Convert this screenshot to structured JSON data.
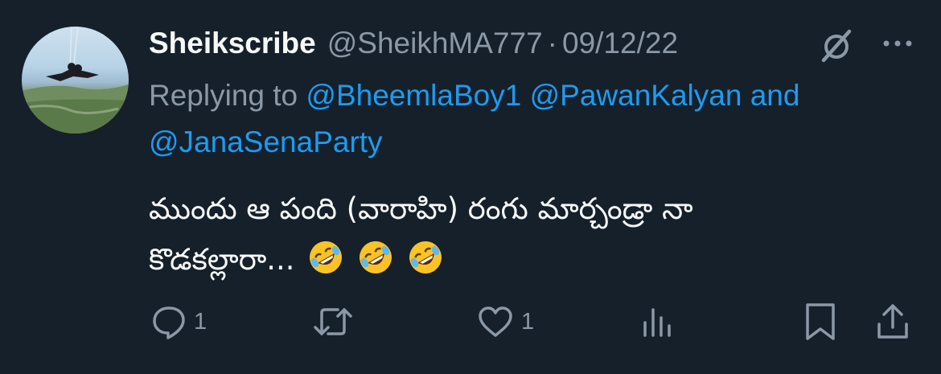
{
  "tweet": {
    "display_name": "Sheikscribe",
    "handle": "@SheikhMA777",
    "separator": "·",
    "date": "09/12/22",
    "replying_to_prefix": "Replying to",
    "mentions": [
      "@BheemlaBoy1",
      "@PawanKalyan",
      "@JanaSenaParty"
    ],
    "mention_conjunction": "and",
    "text_line1": "ముందు ఆ పంది (వారాహి) రంగు మార్చండ్రా నా",
    "text_line2": "కొడకల్లారా...",
    "emojis": [
      "rolling-on-the-floor-laughing",
      "rolling-on-the-floor-laughing",
      "rolling-on-the-floor-laughing"
    ]
  },
  "actions": {
    "reply_count": "1",
    "retweet_count": "",
    "like_count": "1",
    "views_count": ""
  },
  "icons": {
    "header": [
      "grok-icon",
      "more-icon"
    ],
    "actions": [
      "reply-icon",
      "retweet-icon",
      "like-icon",
      "analytics-icon",
      "bookmark-icon",
      "share-icon"
    ]
  },
  "colors": {
    "background": "#15202b",
    "primary_text": "#f7f9f9",
    "secondary_text": "#8b98a5",
    "link": "#1d9bf0"
  }
}
